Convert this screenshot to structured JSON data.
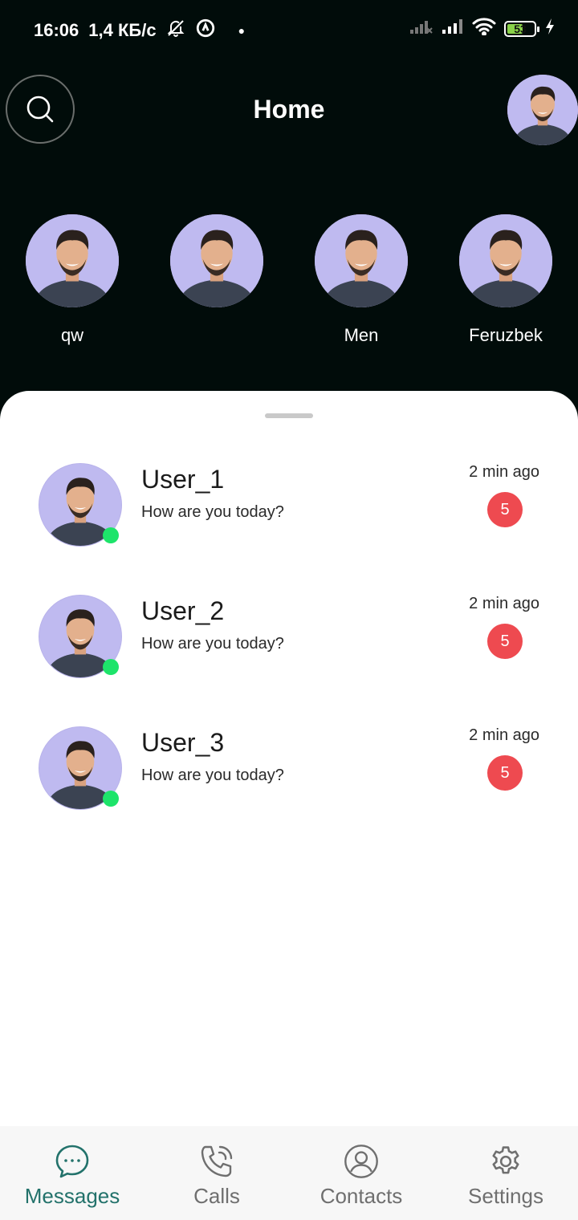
{
  "status_bar": {
    "time": "16:06",
    "speed": "1,4 КБ/с",
    "battery": "53"
  },
  "header": {
    "title": "Home"
  },
  "stories": [
    {
      "label": "qw"
    },
    {
      "label": ""
    },
    {
      "label": "Men"
    },
    {
      "label": "Feruzbek"
    }
  ],
  "chats": [
    {
      "name": "User_1",
      "preview": "How are you today?",
      "time": "2 min ago",
      "unread": "5"
    },
    {
      "name": "User_2",
      "preview": "How are you today?",
      "time": "2 min ago",
      "unread": "5"
    },
    {
      "name": "User_3",
      "preview": "How are you today?",
      "time": "2 min ago",
      "unread": "5"
    }
  ],
  "bottom_nav": {
    "messages": "Messages",
    "calls": "Calls",
    "contacts": "Contacts",
    "settings": "Settings"
  },
  "colors": {
    "header_bg": "#010c0a",
    "accent": "#23726b",
    "online": "#1de46a",
    "badge": "#ee4a50",
    "avatar_bg": "#bfbaf0"
  }
}
